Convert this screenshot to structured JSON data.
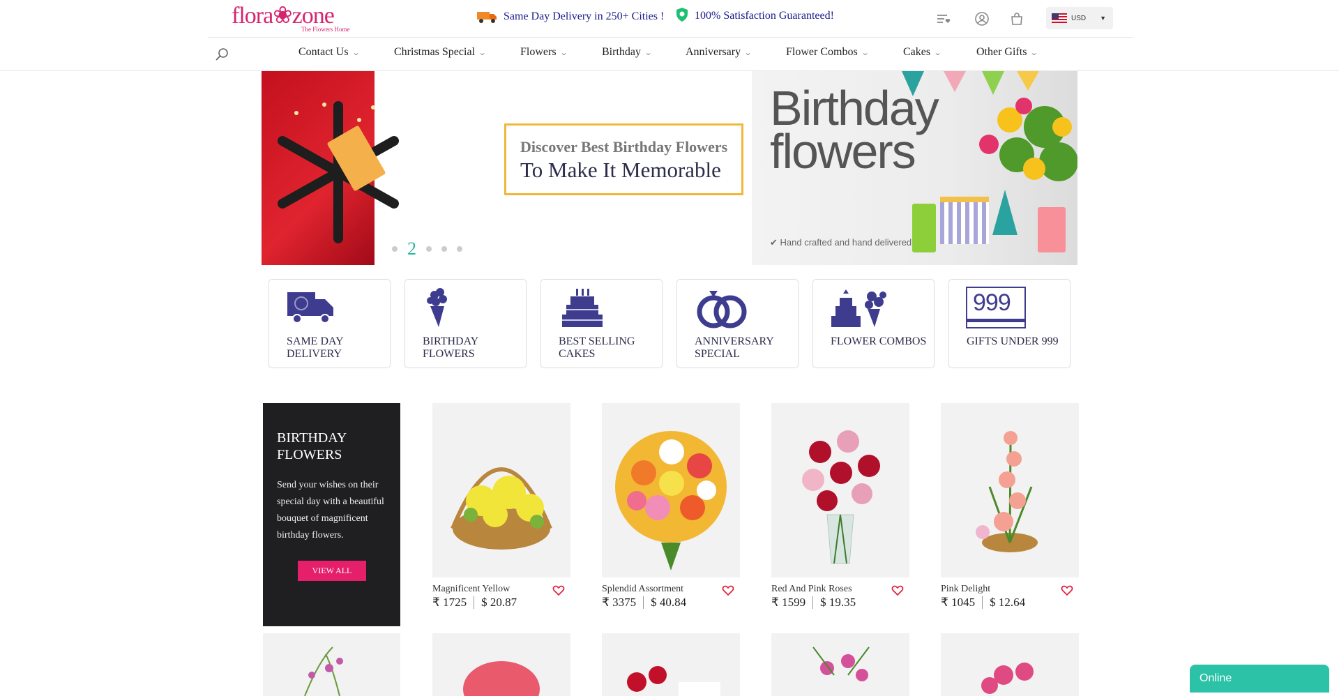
{
  "header": {
    "logo_text": "flora❀zone",
    "logo_tagline": "The Flowers Home",
    "promo_delivery": "Same Day Delivery in 250+ Cities !",
    "promo_guarantee": "100% Satisfaction Guaranteed!",
    "icons": [
      "wishlist-icon",
      "account-icon",
      "cart-icon"
    ],
    "currency": "USD"
  },
  "nav": {
    "items": [
      {
        "label": "Contact Us"
      },
      {
        "label": "Christmas Special"
      },
      {
        "label": "Flowers"
      },
      {
        "label": "Birthday"
      },
      {
        "label": "Anniversary"
      },
      {
        "label": "Flower Combos"
      },
      {
        "label": "Cakes"
      },
      {
        "label": "Other Gifts"
      }
    ]
  },
  "banner": {
    "line1": "Discover Best Birthday Flowers",
    "line2": "To Make It Memorable",
    "current_slide": "2",
    "image_title_1": "Birthday",
    "image_title_2": "flowers",
    "image_footer": "Hand crafted and hand delivered"
  },
  "categories": [
    {
      "label": "SAME DAY DELIVERY",
      "icon": "delivery-truck-icon"
    },
    {
      "label": "BIRTHDAY FLOWERS",
      "icon": "bouquet-icon"
    },
    {
      "label": "BEST SELLING CAKES",
      "icon": "cake-icon"
    },
    {
      "label": "ANNIVERSARY SPECIAL",
      "icon": "rings-icon"
    },
    {
      "label": "FLOWER COMBOS",
      "icon": "combo-icon"
    },
    {
      "label": "GIFTS UNDER 999",
      "icon": "store-999-icon",
      "badge_text": "999"
    }
  ],
  "section": {
    "title": "BIRTHDAY FLOWERS",
    "description": "Send your wishes on their special day with a beautiful bouquet of magnificent birthday flowers.",
    "button": "VIEW ALL"
  },
  "products": [
    {
      "name": "Magnificent Yellow",
      "price_inr": "₹ 1725",
      "price_usd": "$ 20.87"
    },
    {
      "name": "Splendid Assortment",
      "price_inr": "₹ 3375",
      "price_usd": "$ 40.84"
    },
    {
      "name": "Red And Pink Roses",
      "price_inr": "₹ 1599",
      "price_usd": "$ 19.35"
    },
    {
      "name": "Pink Delight",
      "price_inr": "₹ 1045",
      "price_usd": "$ 12.64"
    }
  ],
  "chat": {
    "label": "Online"
  },
  "colors": {
    "brand_pink": "#d6246e",
    "nav_blue": "#1a1a8c",
    "accent_teal": "#2bc2a7",
    "banner_border": "#f1b73a",
    "cta": "#e51f6a"
  }
}
